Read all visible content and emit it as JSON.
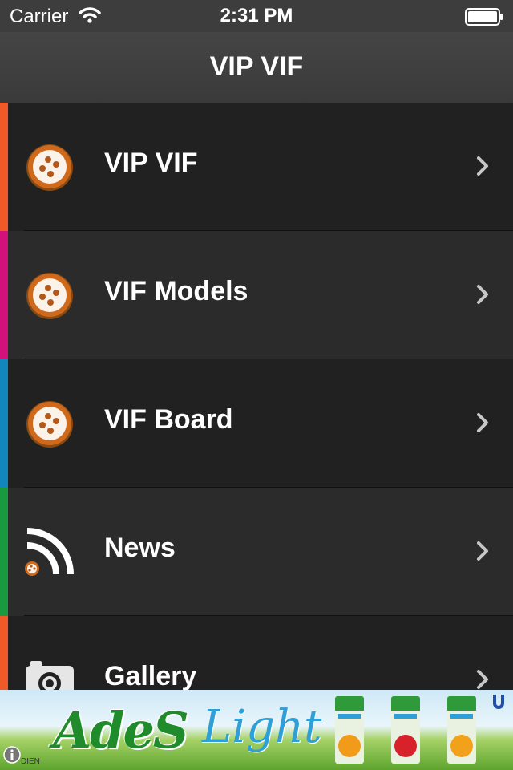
{
  "status_bar": {
    "carrier": "Carrier",
    "time": "2:31 PM"
  },
  "nav": {
    "title": "VIP VIF"
  },
  "menu": [
    {
      "label": "VIP VIF",
      "icon": "vif-logo-icon",
      "accent": "#f05a28"
    },
    {
      "label": "VIF Models",
      "icon": "vif-logo-icon",
      "accent": "#d1127a"
    },
    {
      "label": "VIF Board",
      "icon": "vif-logo-icon",
      "accent": "#1287bd"
    },
    {
      "label": "News",
      "icon": "rss-icon",
      "accent": "#1a9a3f"
    },
    {
      "label": "Gallery",
      "icon": "camera-icon",
      "accent": "#f05a28"
    }
  ],
  "ad": {
    "brand": "AdeS",
    "product": "Light",
    "small_text": "DIEN"
  },
  "colors": {
    "icon_orange": "#c8651b",
    "status_bg": "#3d3d3d",
    "nav_bg": "#424242"
  }
}
